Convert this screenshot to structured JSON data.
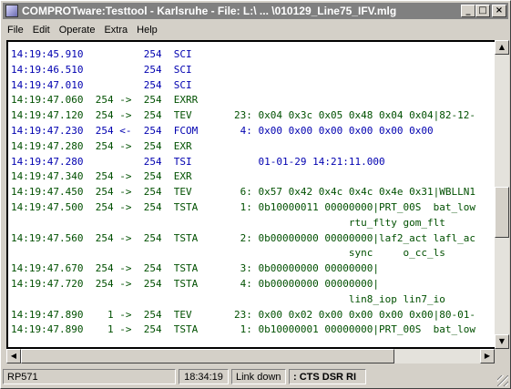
{
  "window": {
    "title": "COMPROTware:Testtool - Karlsruhe - File: L:\\ ... \\010129_Line75_IFV.mlg"
  },
  "menu": [
    "File",
    "Edit",
    "Operate",
    "Extra",
    "Help"
  ],
  "log_rows": [
    {
      "color": "blue",
      "text": "14:19:45.910          254  SCI"
    },
    {
      "color": "blue",
      "text": "14:19:46.510          254  SCI"
    },
    {
      "color": "blue",
      "text": "14:19:47.010          254  SCI"
    },
    {
      "color": "green",
      "text": "14:19:47.060  254 ->  254  EXRR"
    },
    {
      "color": "green",
      "text": "14:19:47.120  254 ->  254  TEV       23: 0x04 0x3c 0x05 0x48 0x04 0x04|82-12-"
    },
    {
      "color": "blue",
      "text": "14:19:47.230  254 <-  254  FCOM       4: 0x00 0x00 0x00 0x00 0x00 0x00"
    },
    {
      "color": "green",
      "text": "14:19:47.280  254 ->  254  EXR"
    },
    {
      "color": "blue",
      "text": "14:19:47.280          254  TSI           01-01-29 14:21:11.000"
    },
    {
      "color": "green",
      "text": "14:19:47.340  254 ->  254  EXR"
    },
    {
      "color": "green",
      "text": "14:19:47.450  254 ->  254  TEV        6: 0x57 0x42 0x4c 0x4c 0x4e 0x31|WBLLN1"
    },
    {
      "color": "green",
      "text": "14:19:47.500  254 ->  254  TSTA       1: 0b10000011 00000000|PRT_00S  bat_low"
    },
    {
      "color": "green",
      "text": "                                                        rtu_flty gom_flt"
    },
    {
      "color": "green",
      "text": "14:19:47.560  254 ->  254  TSTA       2: 0b00000000 00000000|laf2_act lafl_ac"
    },
    {
      "color": "green",
      "text": "                                                        sync     o_cc_ls"
    },
    {
      "color": "green",
      "text": "14:19:47.670  254 ->  254  TSTA       3: 0b00000000 00000000|"
    },
    {
      "color": "green",
      "text": "14:19:47.720  254 ->  254  TSTA       4: 0b00000000 00000000|"
    },
    {
      "color": "green",
      "text": "                                                        lin8_iop lin7_io"
    },
    {
      "color": "green",
      "text": "14:19:47.890    1 ->  254  TEV       23: 0x00 0x02 0x00 0x00 0x00 0x00|80-01-"
    },
    {
      "color": "green",
      "text": "14:19:47.890    1 ->  254  TSTA       1: 0b10000001 00000000|PRT_00S  bat_low"
    }
  ],
  "status": {
    "port": "RP571",
    "time": "18:34:19",
    "link": "Link down",
    "signals": ": CTS DSR RI"
  },
  "icons": [
    "app-icon",
    "minimize-icon",
    "maximize-icon",
    "close-icon",
    "arrow-up-icon",
    "arrow-down-icon",
    "arrow-left-icon",
    "arrow-right-icon"
  ]
}
